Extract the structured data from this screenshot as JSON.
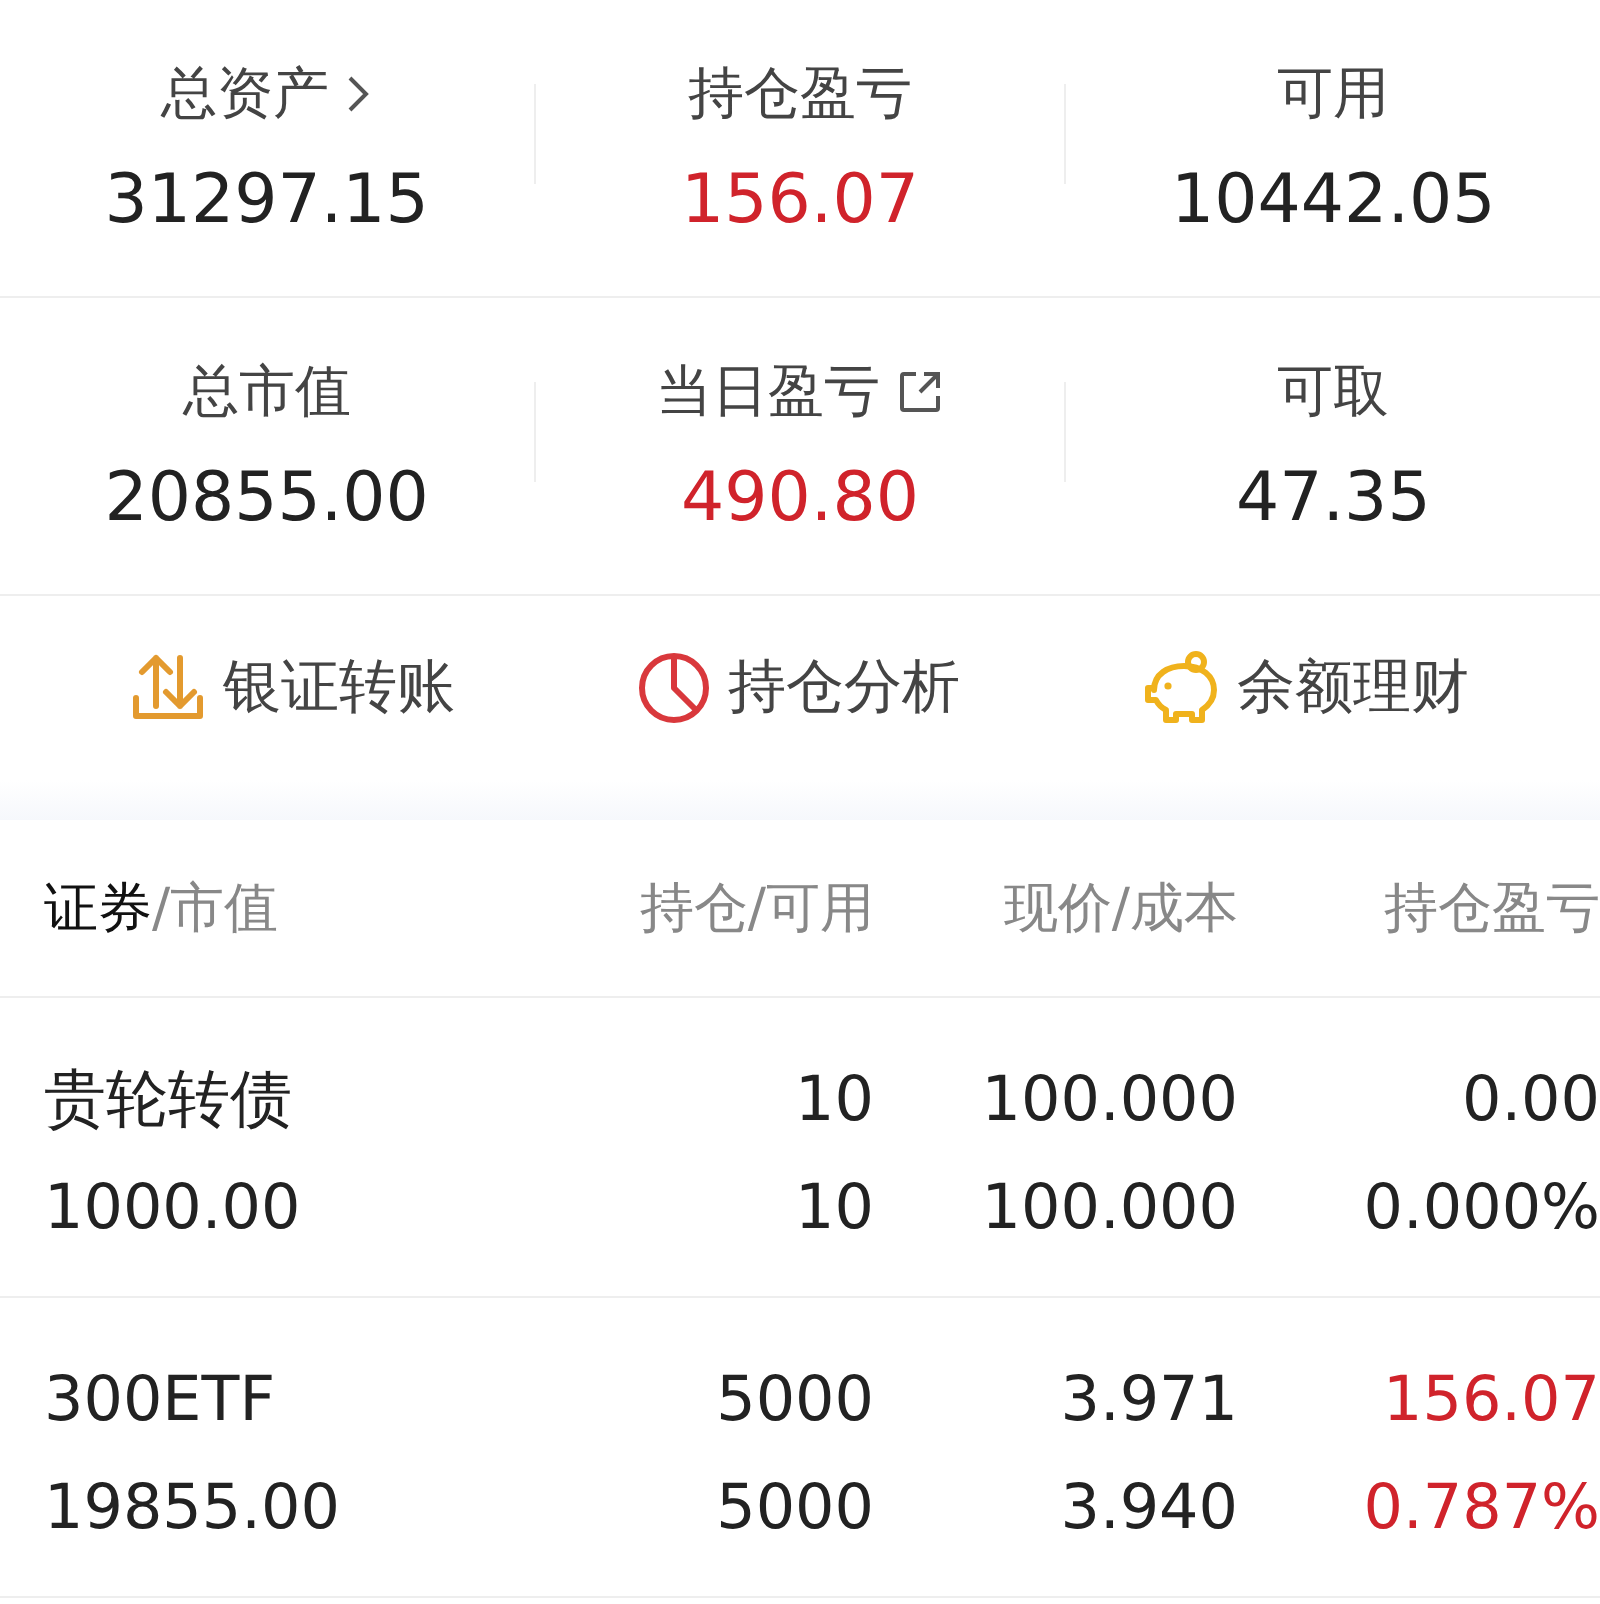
{
  "summary": [
    {
      "kind": "drilldown",
      "label": "总资产",
      "value": "31297.15",
      "color": "#222222"
    },
    {
      "kind": "plain",
      "label": "持仓盈亏",
      "value": "156.07",
      "color": "#d0232b"
    },
    {
      "kind": "plain",
      "label": "可用",
      "value": "10442.05",
      "color": "#222222"
    },
    {
      "kind": "plain",
      "label": "总市值",
      "value": "20855.00",
      "color": "#222222"
    },
    {
      "kind": "external",
      "label": "当日盈亏",
      "value": "490.80",
      "color": "#d0232b"
    },
    {
      "kind": "plain",
      "label": "可取",
      "value": "47.35",
      "color": "#222222"
    }
  ],
  "actions": [
    {
      "kind": "transfer",
      "label": "银证转账"
    },
    {
      "kind": "pie",
      "label": "持仓分析"
    },
    {
      "kind": "piggy",
      "label": "余额理财"
    }
  ],
  "table": {
    "columns": [
      {
        "primary": "证券",
        "secondary": "/市值"
      },
      {
        "secondary": "持仓/可用"
      },
      {
        "secondary": "现价/成本"
      },
      {
        "secondary": "持仓盈亏"
      }
    ],
    "rows": [
      {
        "name": "贵轮转债",
        "market_value": "1000.00",
        "holding": "10",
        "available": "10",
        "price": "100.000",
        "cost": "100.000",
        "profit": "0.00",
        "profit_rate": "0.000%",
        "color": "#222222"
      },
      {
        "name": "300ETF",
        "market_value": "19855.00",
        "holding": "5000",
        "available": "5000",
        "price": "3.971",
        "cost": "3.940",
        "profit": "156.07",
        "profit_rate": "0.787%",
        "color": "#d0232b"
      }
    ]
  }
}
